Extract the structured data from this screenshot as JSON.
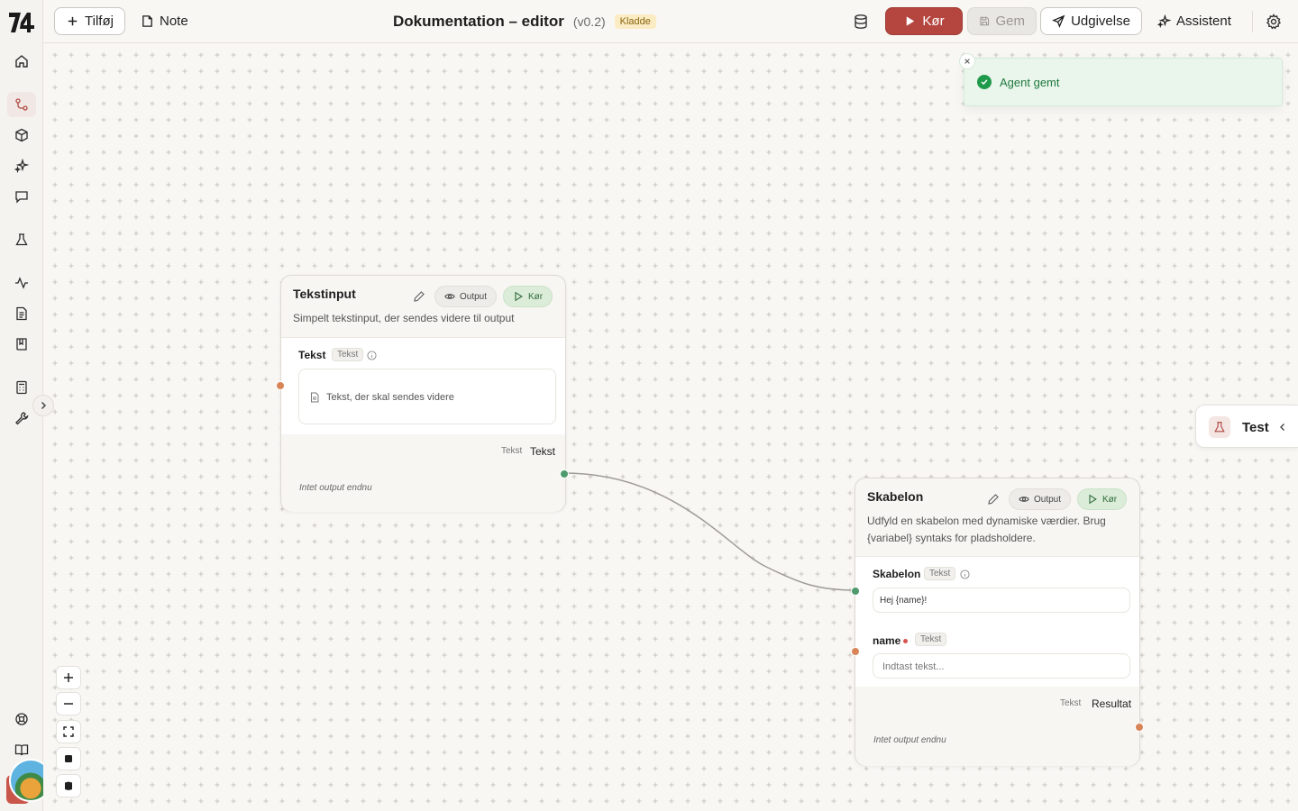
{
  "toolbar": {
    "add_label": "Tilføj",
    "note_label": "Note",
    "title": "Dokumentation – editor",
    "version": "(v0.2)",
    "status_badge": "Kladde",
    "run_label": "Kør",
    "save_label": "Gem",
    "publish_label": "Udgivelse",
    "assistant_label": "Assistent"
  },
  "sidebar": {
    "items": [
      {
        "name": "home-icon"
      },
      {
        "name": "flows-icon",
        "active": true
      },
      {
        "name": "box-icon"
      },
      {
        "name": "sparkles-icon"
      },
      {
        "name": "chat-icon"
      },
      {
        "name": "flask-icon"
      },
      {
        "name": "activity-icon"
      },
      {
        "name": "document-icon"
      },
      {
        "name": "book-icon"
      },
      {
        "name": "calculator-icon"
      },
      {
        "name": "wrench-icon"
      },
      {
        "name": "help-icon"
      },
      {
        "name": "docs-icon"
      }
    ]
  },
  "toast": {
    "message": "Agent gemt"
  },
  "test_panel": {
    "label": "Test"
  },
  "nodes": [
    {
      "title": "Tekstinput",
      "description": "Simpelt tekstinput, der sendes videre til output",
      "output_pill": "Output",
      "run_pill": "Kør",
      "field_label": "Tekst",
      "field_type": "Tekst",
      "field_placeholder": "Tekst, der skal sendes videre",
      "output_type": "Tekst",
      "output_label": "Tekst",
      "no_output": "Intet output endnu"
    },
    {
      "title": "Skabelon",
      "description": "Udfyld en skabelon med dynamiske værdier. Brug {variabel} syntaks for pladsholdere.",
      "output_pill": "Output",
      "run_pill": "Kør",
      "template_label": "Skabelon",
      "template_type": "Tekst",
      "template_value": "Hej {name}!",
      "name_label": "name",
      "name_type": "Tekst",
      "name_placeholder": "Indtast tekst...",
      "output_type": "Tekst",
      "output_label": "Resultat",
      "no_output": "Intet output endnu"
    }
  ],
  "colors": {
    "accent": "#b4463f",
    "success": "#1f9a4b",
    "handle_orange": "#d98456",
    "handle_green": "#4e9a6c"
  }
}
